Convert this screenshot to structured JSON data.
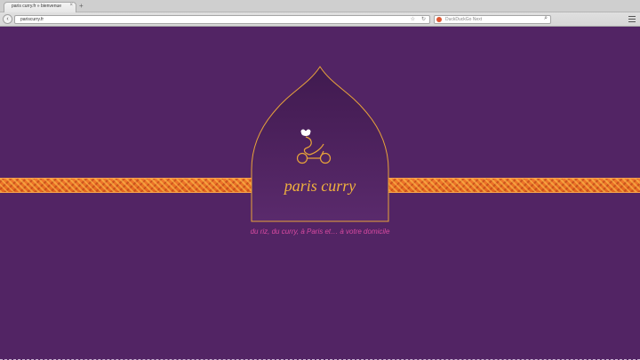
{
  "browser": {
    "tab_title": "paris curry.fr » bienvenue",
    "tab_close": "×",
    "new_tab": "+",
    "back": "‹",
    "url": "pariscurry.fr",
    "star": "☆",
    "reload": "↻",
    "search_placeholder": "DuckDuckGo Next",
    "search_glyph": "⌕"
  },
  "page": {
    "brand": "paris curry",
    "tagline": "du riz, du curry, à Paris et… à votre domicile"
  },
  "colors": {
    "background": "#522464",
    "gold": "#e8a33a",
    "pattern": "#e3641f",
    "tagline": "#d84aa0"
  }
}
